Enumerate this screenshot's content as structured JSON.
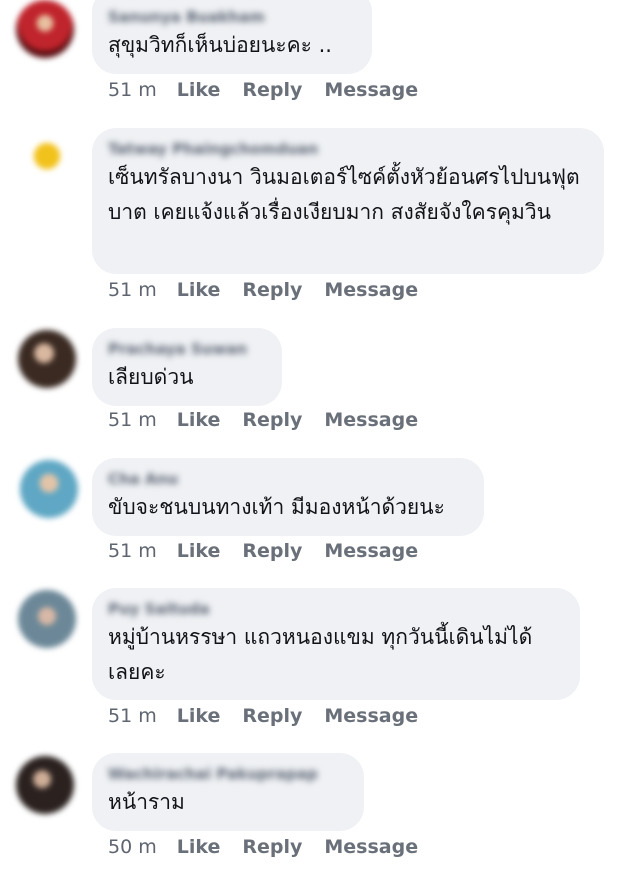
{
  "comments": [
    {
      "author": "Sanunya Buakham",
      "text": "สุขุมวิทก็เห็นบ่อยนะคะ  ..",
      "time": "51 m",
      "like": "Like",
      "reply": "Reply",
      "message": "Message"
    },
    {
      "author": "Tatway Phaingchomduan",
      "text": "เซ็นทรัลบางนา วินมอเตอร์ไซค์ตั้งหัวย้อนศรไปบนฟุตบาต เคยแจ้งแล้วเรื่องเงียบมาก สงสัยจังใครคุมวิน",
      "time": "51 m",
      "like": "Like",
      "reply": "Reply",
      "message": "Message"
    },
    {
      "author": "Prachaya Suwan",
      "text": "เลียบด่วน",
      "time": "51 m",
      "like": "Like",
      "reply": "Reply",
      "message": "Message"
    },
    {
      "author": "Cha Anu",
      "text": "ขับจะชนบนทางเท้า มีมองหน้าด้วยนะ",
      "time": "51 m",
      "like": "Like",
      "reply": "Reply",
      "message": "Message"
    },
    {
      "author": "Puy Saituda",
      "text": "หมู่บ้านหรรษา แถวหนองแขม ทุกวันนี้เดินไม่ได้เลยคะ",
      "time": "51 m",
      "like": "Like",
      "reply": "Reply",
      "message": "Message"
    },
    {
      "author": "Wachirachai Pakuprapap",
      "text": "หน้าราม",
      "time": "50 m",
      "like": "Like",
      "reply": "Reply",
      "message": "Message"
    }
  ],
  "avatar_colors": [
    "#b3222a",
    "#e6a514",
    "#3b2a24",
    "#7bb4c9",
    "#6c8a9e",
    "#2b2220"
  ]
}
